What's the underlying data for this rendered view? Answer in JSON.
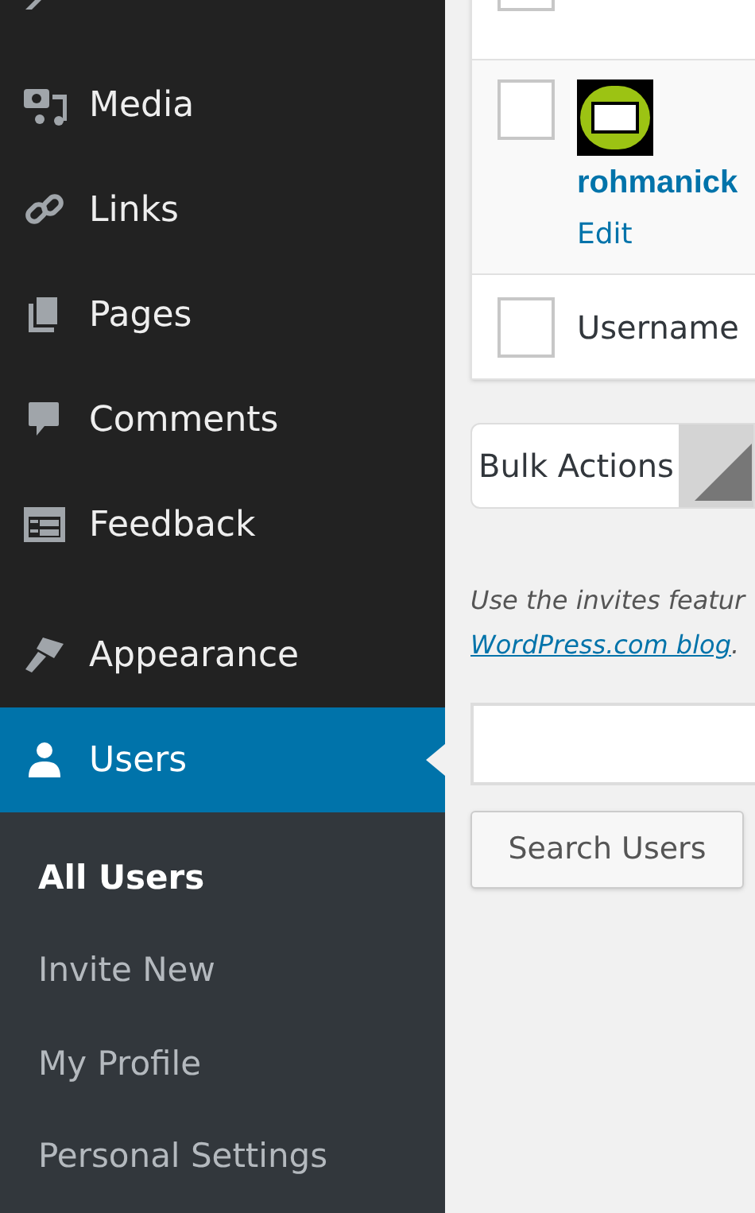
{
  "sidebar": {
    "items": [
      {
        "label": "Media",
        "selected": false
      },
      {
        "label": "Links",
        "selected": false
      },
      {
        "label": "Pages",
        "selected": false
      },
      {
        "label": "Comments",
        "selected": false
      },
      {
        "label": "Feedback",
        "selected": false
      },
      {
        "label": "Appearance",
        "selected": false
      },
      {
        "label": "Users",
        "selected": true
      }
    ],
    "submenu": [
      {
        "label": "All Users",
        "selected": true
      },
      {
        "label": "Invite New",
        "selected": false
      },
      {
        "label": "My Profile",
        "selected": false
      },
      {
        "label": "Personal Settings",
        "selected": false
      }
    ]
  },
  "table": {
    "rows": [
      {
        "kind": "cut",
        "checked": false
      },
      {
        "kind": "user",
        "name": "rohmanick",
        "action": "Edit",
        "checked": false
      },
      {
        "kind": "heading",
        "label": "Username",
        "checked": false
      }
    ]
  },
  "bulk_actions": {
    "value": "Bulk Actions"
  },
  "note": {
    "text": "Use the invites featur",
    "link": "WordPress.com blog",
    "after": "."
  },
  "search": {
    "button": "Search Users"
  }
}
